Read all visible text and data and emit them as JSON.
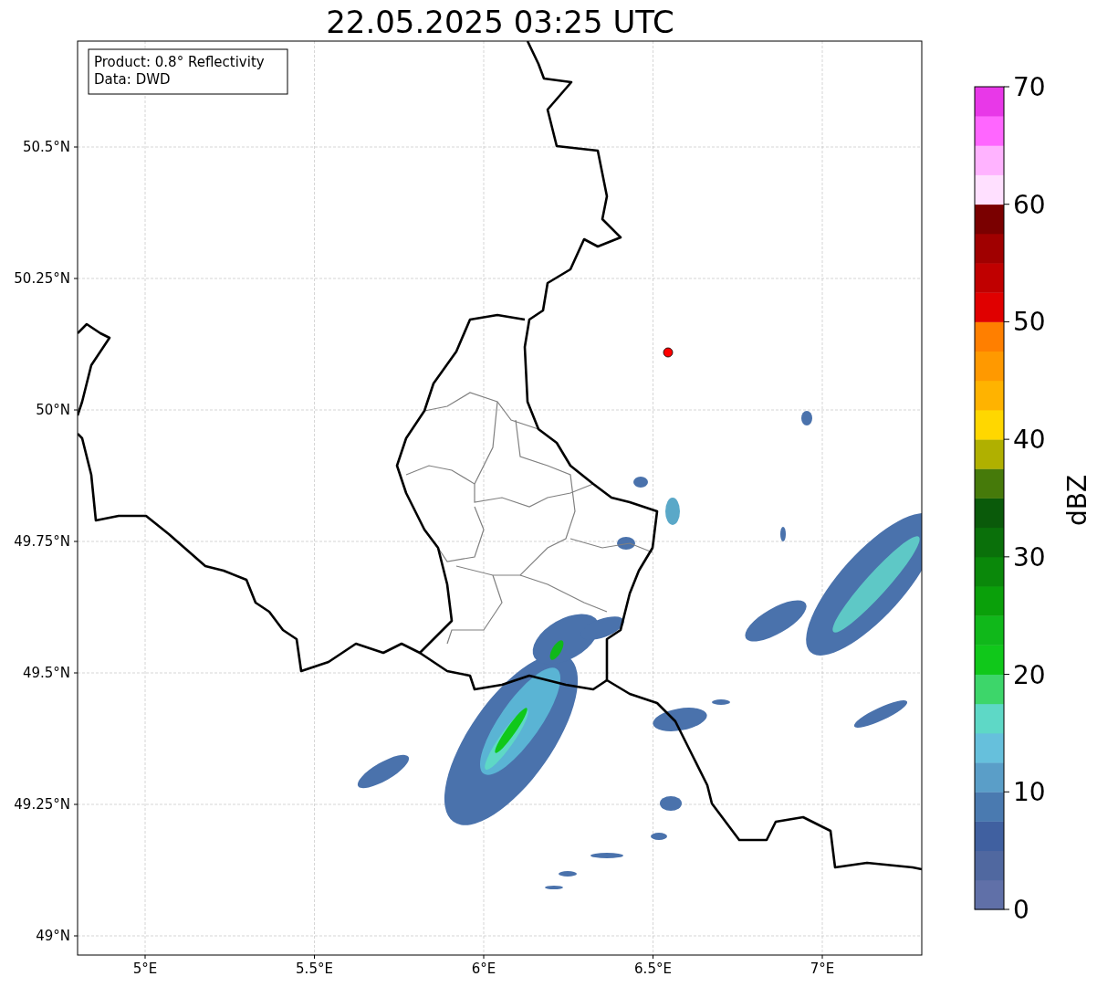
{
  "title": "22.05.2025 03:25 UTC",
  "info_box": [
    "Product: 0.8° Reflectivity",
    "Data: DWD"
  ],
  "x_ticks": [
    "5°E",
    "5.5°E",
    "6°E",
    "6.5°E",
    "7°E"
  ],
  "y_ticks": [
    "50.5°N",
    "50.25°N",
    "50°N",
    "49.75°N",
    "49.5°N",
    "49.25°N",
    "49°N"
  ],
  "colorbar": {
    "label": "dBZ",
    "ticks": [
      "70",
      "60",
      "50",
      "40",
      "30",
      "20",
      "10",
      "0"
    ],
    "bands": [
      {
        "color": "#6070a8"
      },
      {
        "color": "#5068a0"
      },
      {
        "color": "#4060a0"
      },
      {
        "color": "#4a7ab0"
      },
      {
        "color": "#5a9ec8"
      },
      {
        "color": "#66c0dc"
      },
      {
        "color": "#5ed8c6"
      },
      {
        "color": "#3dd66a"
      },
      {
        "color": "#10c81a"
      },
      {
        "color": "#10b81a"
      },
      {
        "color": "#0aa00a"
      },
      {
        "color": "#0a880a"
      },
      {
        "color": "#0a700a"
      },
      {
        "color": "#0a5a0a"
      },
      {
        "color": "#467a0a"
      },
      {
        "color": "#b0b000"
      },
      {
        "color": "#ffd700"
      },
      {
        "color": "#ffb300"
      },
      {
        "color": "#ff9900"
      },
      {
        "color": "#ff7f00"
      },
      {
        "color": "#e00000"
      },
      {
        "color": "#c00000"
      },
      {
        "color": "#a00000"
      },
      {
        "color": "#7a0000"
      },
      {
        "color": "#ffe0ff"
      },
      {
        "color": "#ffb3ff"
      },
      {
        "color": "#ff66ff"
      },
      {
        "color": "#e838e8"
      }
    ]
  }
}
